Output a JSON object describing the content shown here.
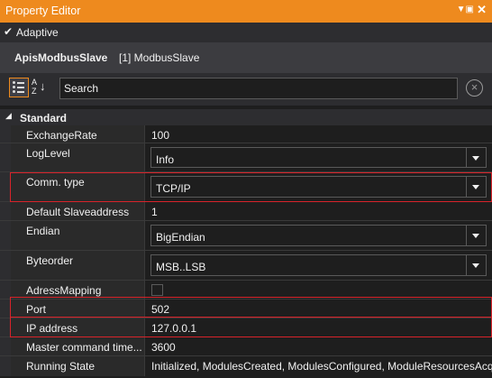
{
  "window": {
    "title": "Property Editor"
  },
  "adaptive": {
    "label": "Adaptive",
    "checked": true
  },
  "object": {
    "name": "ApisModbusSlave",
    "type": "[1] ModbusSlave"
  },
  "search": {
    "placeholder": "Search"
  },
  "category": {
    "label": "Standard"
  },
  "properties": [
    {
      "name": "ExchangeRate",
      "value": "100",
      "editor": "text"
    },
    {
      "name": "LogLevel",
      "value": "Info",
      "editor": "dropdown"
    },
    {
      "name": "Comm. type",
      "value": "TCP/IP",
      "editor": "dropdown",
      "highlighted": true
    },
    {
      "name": "Default Slaveaddress",
      "value": "1",
      "editor": "text"
    },
    {
      "name": "Endian",
      "value": "BigEndian",
      "editor": "dropdown"
    },
    {
      "name": "Byteorder",
      "value": "MSB..LSB",
      "editor": "dropdown"
    },
    {
      "name": "AdressMapping",
      "value": "",
      "editor": "checkbox",
      "checked": false
    },
    {
      "name": "Port",
      "value": "502",
      "editor": "text",
      "highlighted": true
    },
    {
      "name": "IP address",
      "value": "127.0.0.1",
      "editor": "text",
      "highlighted": true
    },
    {
      "name": "Master command time...",
      "value": "3600",
      "editor": "text"
    },
    {
      "name": "Running State",
      "value": "Initialized, ModulesCreated, ModulesConfigured, ModuleResourcesAcq",
      "editor": "text"
    }
  ],
  "colors": {
    "title_bar": "#ee8a1e",
    "highlight": "#d8232a",
    "background": "#2d2d30"
  }
}
